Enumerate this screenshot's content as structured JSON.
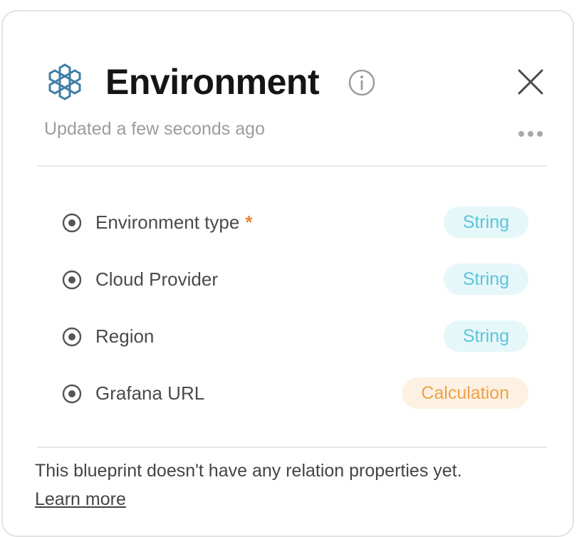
{
  "panel": {
    "title": "Environment",
    "subtitle": "Updated a few seconds ago",
    "entity_icon": "hexagon-cluster-icon",
    "info_icon": "info-icon",
    "close_icon": "close-icon",
    "more_icon": "more-horizontal-icon"
  },
  "properties": [
    {
      "label": "Environment type",
      "required": true,
      "required_mark": "*",
      "type": "String",
      "type_kind": "string"
    },
    {
      "label": "Cloud Provider",
      "required": false,
      "type": "String",
      "type_kind": "string"
    },
    {
      "label": "Region",
      "required": false,
      "type": "String",
      "type_kind": "string"
    },
    {
      "label": "Grafana URL",
      "required": false,
      "type": "Calculation",
      "type_kind": "calculation"
    }
  ],
  "footer": {
    "message": "This blueprint doesn't have any relation properties yet.",
    "link_label": "Learn more"
  },
  "colors": {
    "accent_blue": "#3f7ea6",
    "string_badge_bg": "#e6f7fa",
    "string_badge_text": "#5cc5d8",
    "calculation_badge_bg": "#fdf1e3",
    "calculation_badge_text": "#eda24a",
    "required_mark": "#f0803c"
  }
}
